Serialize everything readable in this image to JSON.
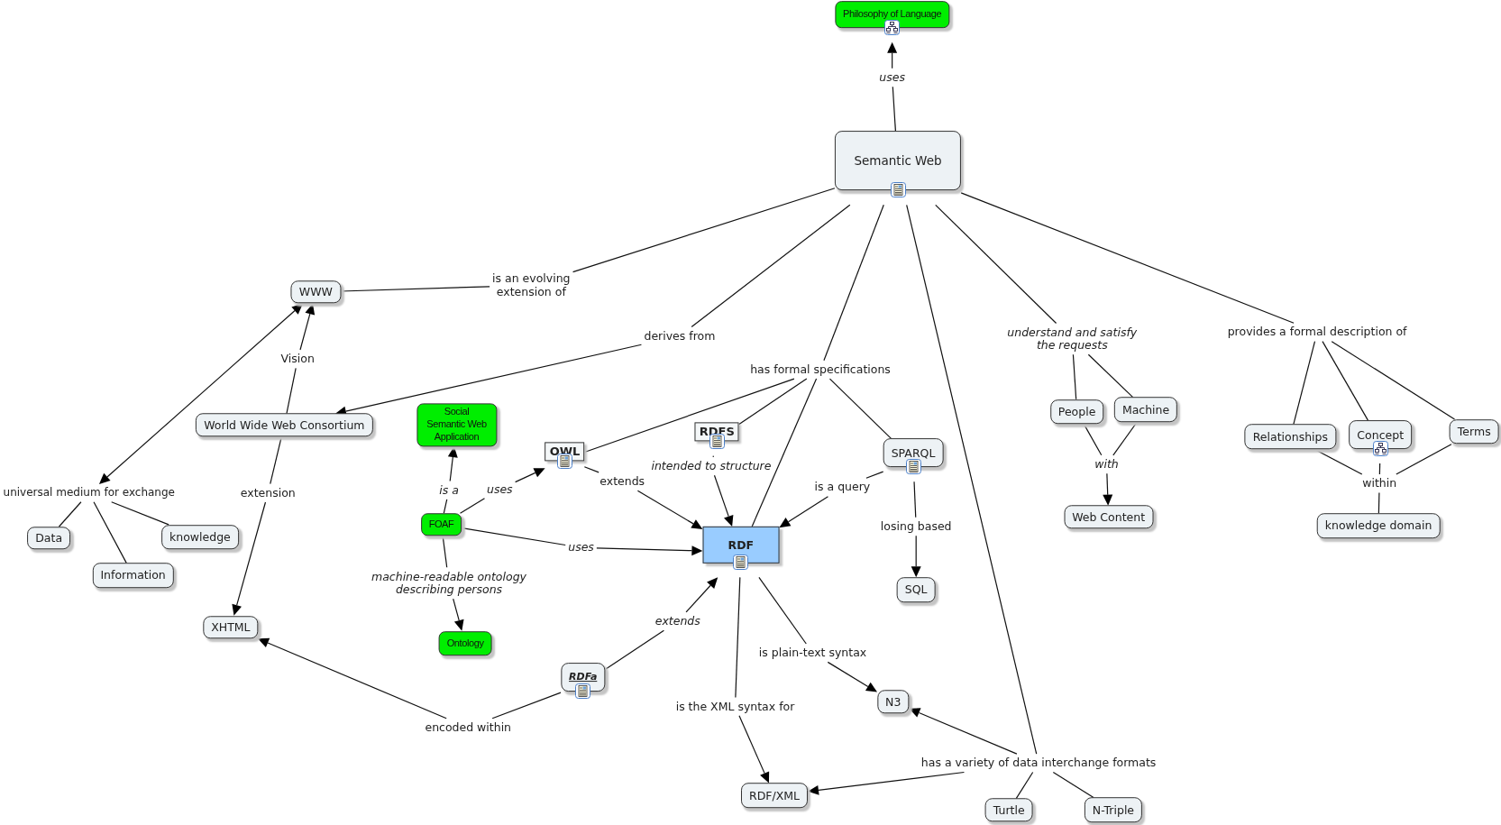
{
  "concepts": [
    {
      "label": "Philosophy of Language",
      "kind": "highlight",
      "has_submap": true
    },
    {
      "label": "Semantic Web",
      "kind": "root",
      "has_document": true
    },
    {
      "label": "WWW",
      "kind": "concept"
    },
    {
      "label": "World Wide Web Consortium",
      "kind": "concept"
    },
    {
      "label": "Social Semantic Web Application",
      "kind": "highlight"
    },
    {
      "label": "OWL",
      "kind": "boxed",
      "has_document": true
    },
    {
      "label": "RDFS",
      "kind": "boxed",
      "has_document": true
    },
    {
      "label": "SPARQL",
      "kind": "concept",
      "has_document": true
    },
    {
      "label": "People",
      "kind": "concept"
    },
    {
      "label": "Machine",
      "kind": "concept"
    },
    {
      "label": "Relationships",
      "kind": "concept"
    },
    {
      "label": "Concept",
      "kind": "concept",
      "has_submap": true
    },
    {
      "label": "Terms",
      "kind": "concept"
    },
    {
      "label": "FOAF",
      "kind": "highlight"
    },
    {
      "label": "Data",
      "kind": "concept"
    },
    {
      "label": "knowledge",
      "kind": "concept"
    },
    {
      "label": "RDF",
      "kind": "focus",
      "has_document": true
    },
    {
      "label": "Web Content",
      "kind": "concept"
    },
    {
      "label": "knowledge domain",
      "kind": "concept"
    },
    {
      "label": "Information",
      "kind": "concept"
    },
    {
      "label": "SQL",
      "kind": "concept"
    },
    {
      "label": "XHTML",
      "kind": "concept"
    },
    {
      "label": "Ontology",
      "kind": "highlight"
    },
    {
      "label": "RDFa",
      "kind": "concept",
      "has_document": true,
      "hyperlink": true
    },
    {
      "label": "N3",
      "kind": "concept"
    },
    {
      "label": "RDF/XML",
      "kind": "concept"
    },
    {
      "label": "Turtle",
      "kind": "concept"
    },
    {
      "label": "N-Triple",
      "kind": "concept"
    }
  ],
  "linking_phrases": [
    {
      "label": "uses",
      "emphasized": true
    },
    {
      "label": "is an evolving\nextension of",
      "emphasized": false
    },
    {
      "label": "derives from",
      "emphasized": false
    },
    {
      "label": "has formal specifications",
      "emphasized": false
    },
    {
      "label": "understand and satisfy\nthe requests",
      "emphasized": true
    },
    {
      "label": "provides a formal description of",
      "emphasized": false
    },
    {
      "label": "Vision",
      "emphasized": false
    },
    {
      "label": "universal medium for exchange",
      "emphasized": false
    },
    {
      "label": "extension",
      "emphasized": false
    },
    {
      "label": "is a",
      "emphasized": true
    },
    {
      "label": "uses",
      "emphasized": true
    },
    {
      "label": "extends",
      "emphasized": false
    },
    {
      "label": "intended to structure",
      "emphasized": true
    },
    {
      "label": "is a query",
      "emphasized": false
    },
    {
      "label": "uses",
      "emphasized": true
    },
    {
      "label": "machine-readable ontology\ndescribing persons",
      "emphasized": true
    },
    {
      "label": "losing based",
      "emphasized": false
    },
    {
      "label": "extends",
      "emphasized": true
    },
    {
      "label": "is plain-text syntax",
      "emphasized": false
    },
    {
      "label": "is the XML syntax for",
      "emphasized": false
    },
    {
      "label": "encoded within",
      "emphasized": false
    },
    {
      "label": "has a variety of data interchange formats",
      "emphasized": false
    },
    {
      "label": "with",
      "emphasized": true
    },
    {
      "label": "within",
      "emphasized": false
    }
  ]
}
